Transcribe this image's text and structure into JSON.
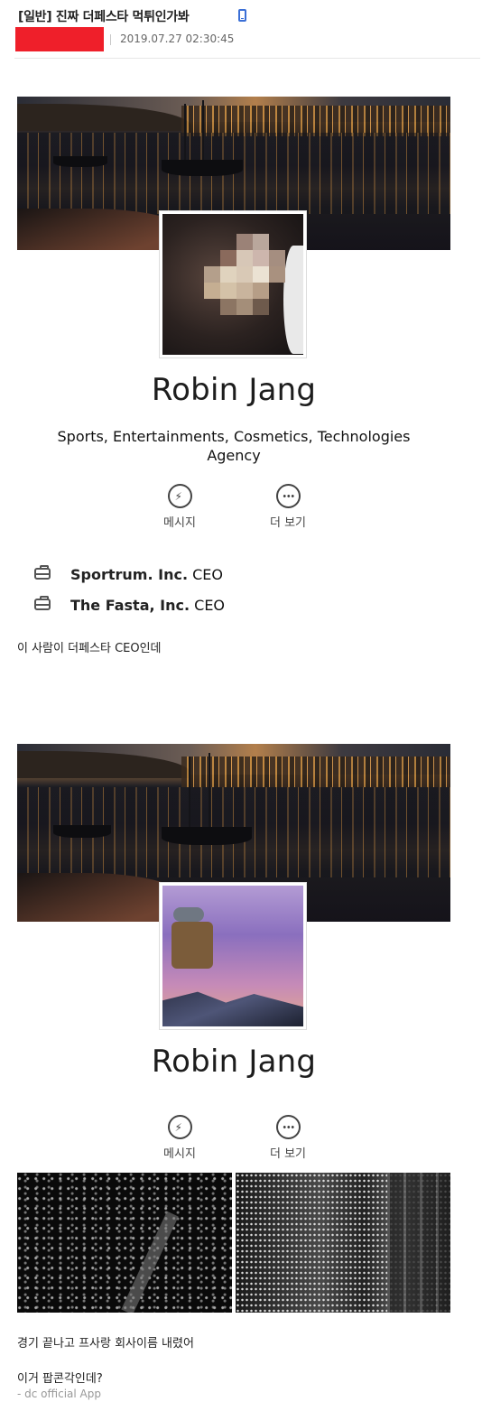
{
  "post": {
    "title": "[일반] 진짜 더페스타 먹튀인가봐",
    "date": "2019.07.27 02:30:45"
  },
  "profile_1": {
    "name": "Robin Jang",
    "tagline": "Sports, Entertainments, Cosmetics, Technologies Agency",
    "actions": [
      {
        "label": "메시지",
        "icon": "messenger-icon"
      },
      {
        "label": "더 보기",
        "icon": "more-icon"
      }
    ],
    "work": [
      {
        "company": "Sportrum. Inc.",
        "role": "CEO"
      },
      {
        "company": "The Fasta, Inc.",
        "role": "CEO"
      }
    ]
  },
  "caption_1": "이 사람이 더페스타 CEO인데",
  "profile_2": {
    "name": "Robin Jang",
    "actions": [
      {
        "label": "메시지",
        "icon": "messenger-icon"
      },
      {
        "label": "더 보기",
        "icon": "more-icon"
      }
    ]
  },
  "caption_2": "경기 끝나고 프사랑 회사이름 내렸어",
  "caption_3": "이거 팝콘각인데?",
  "footer": "- dc official App",
  "colors": {
    "redaction": "#ef1f2a",
    "mobile_icon": "#3b6fd6"
  }
}
